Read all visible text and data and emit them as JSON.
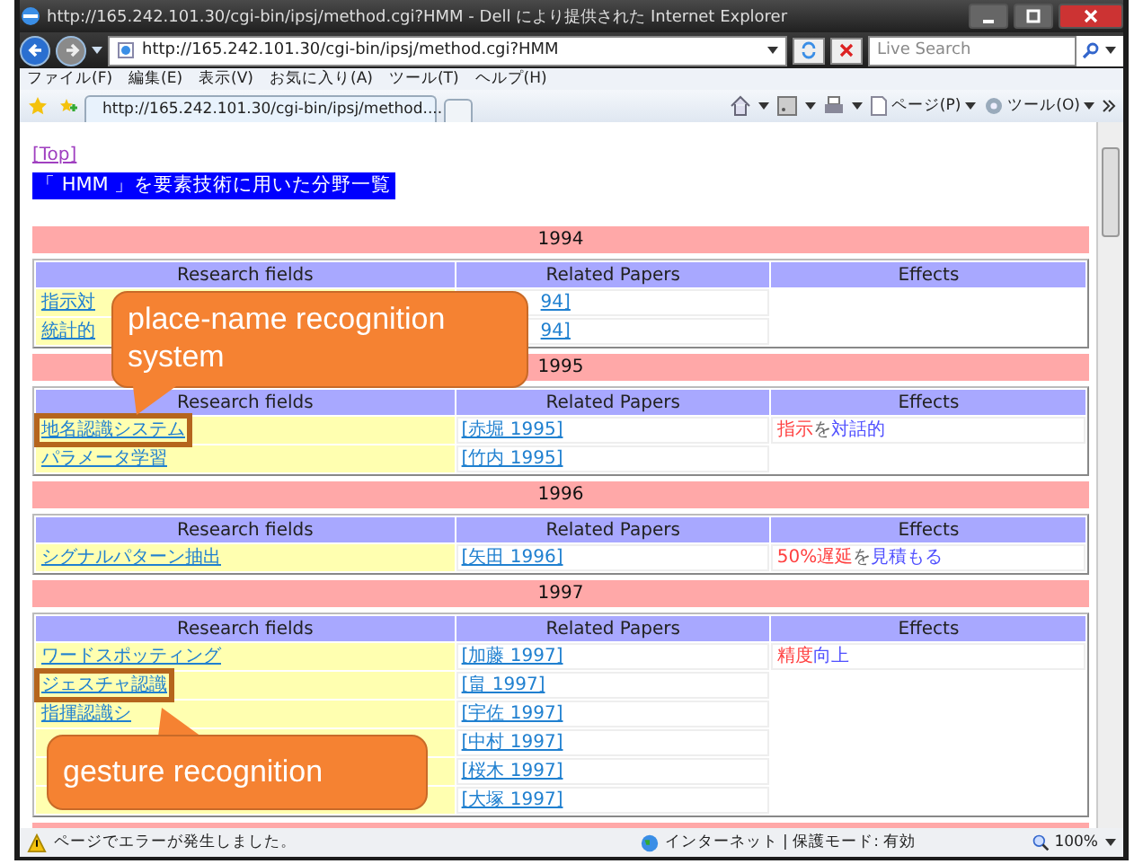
{
  "window": {
    "title": "http://165.242.101.30/cgi-bin/ipsj/method.cgi?HMM - Dell により提供された Internet Explorer"
  },
  "address_bar": {
    "url": "http://165.242.101.30/cgi-bin/ipsj/method.cgi?HMM",
    "search_placeholder": "Live Search"
  },
  "menu": [
    "ファイル(F)",
    "編集(E)",
    "表示(V)",
    "お気に入り(A)",
    "ツール(T)",
    "ヘルプ(H)"
  ],
  "tab": {
    "title": "http://165.242.101.30/cgi-bin/ipsj/method...."
  },
  "command_bar": [
    "ページ(P)",
    "ツール(O)"
  ],
  "page": {
    "top_link": "[Top]",
    "heading": "「 HMM 」を要素技術に用いた分野一覧",
    "sections": [
      {
        "year": "1994",
        "columns": [
          "Research fields",
          "Related Papers",
          "Effects"
        ],
        "rows": [
          {
            "field": "指示対",
            "paper": "94]",
            "cut": true,
            "highlighted": false
          },
          {
            "field": "統計的",
            "paper": "94]",
            "cut": true,
            "highlighted": false
          }
        ]
      },
      {
        "year": "1995",
        "columns": [
          "Research fields",
          "Related Papers",
          "Effects"
        ],
        "rows": [
          {
            "field": "地名認識システム",
            "paper": "[赤堀 1995]",
            "cut": false,
            "highlighted": true
          },
          {
            "field": "パラメータ学習",
            "paper": "[竹内 1995]",
            "cut": false,
            "highlighted": false
          }
        ],
        "effects": [
          {
            "text": "指示",
            "color": "#ff4040"
          },
          {
            "text": "を",
            "color": "#666666"
          },
          {
            "text": "対話的",
            "color": "#5050ff"
          }
        ]
      },
      {
        "year": "1996",
        "columns": [
          "Research fields",
          "Related Papers",
          "Effects"
        ],
        "rows": [
          {
            "field": "シグナルパターン抽出",
            "paper": "[矢田 1996]",
            "cut": false,
            "highlighted": false
          }
        ],
        "effects": [
          {
            "text": "50%遅延",
            "color": "#ff4040"
          },
          {
            "text": "を",
            "color": "#666666"
          },
          {
            "text": "見積もる",
            "color": "#5050ff"
          }
        ]
      },
      {
        "year": "1997",
        "columns": [
          "Research fields",
          "Related Papers",
          "Effects"
        ],
        "rows": [
          {
            "field": "ワードスポッティング",
            "paper": "[加藤 1997]",
            "cut": false,
            "highlighted": false
          },
          {
            "field": "ジェスチャ認識",
            "paper": "[畠 1997]",
            "cut": false,
            "highlighted": true
          },
          {
            "field": "指揮認識シ",
            "paper": "[宇佐 1997]",
            "cut": false,
            "highlighted": false
          },
          {
            "paper": "[中村 1997]",
            "cut": false,
            "highlighted": false
          },
          {
            "paper": "[桜木 1997]",
            "cut": false,
            "highlighted": false
          },
          {
            "paper": "[大塚 1997]",
            "cut": false,
            "highlighted": false
          }
        ],
        "effects": [
          {
            "text": "精度",
            "color": "#ff4040"
          },
          {
            "text": "向上",
            "color": "#5050ff"
          }
        ]
      }
    ]
  },
  "callouts": [
    {
      "text": "place-name recognition system"
    },
    {
      "text": "gesture recognition"
    }
  ],
  "status_bar": {
    "message": "ページでエラーが発生しました。",
    "zone": "インターネット | 保護モード: 有効",
    "zoom": "100%"
  }
}
